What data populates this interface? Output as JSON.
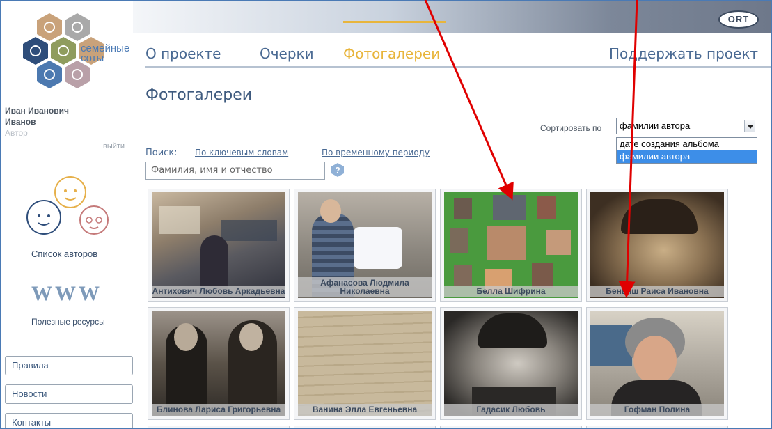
{
  "header": {
    "sponsor_logo": "ORT"
  },
  "logo": {
    "line1": "семейные",
    "line2": "соты"
  },
  "user": {
    "name_line1": "Иван Иванович",
    "name_line2": "Иванов",
    "role": "Автор",
    "logout": "выйти"
  },
  "sidebar": {
    "authors_label": "Список авторов",
    "www_label": "WWW",
    "resources_label": "Полезные ресурсы",
    "buttons": [
      "Правила",
      "Новости",
      "Контакты"
    ]
  },
  "nav": {
    "items": [
      "О проекте",
      "Очерки",
      "Фотогалереи"
    ],
    "support": "Поддержать проект",
    "active": "Фотогалереи"
  },
  "page": {
    "title": "Фотогалереи"
  },
  "sort": {
    "label": "Сортировать по",
    "selected": "фамилии автора",
    "options": [
      "дате создания альбома",
      "фамилии автора"
    ]
  },
  "search": {
    "label": "Поиск:",
    "by_keywords": "По ключевым словам",
    "by_period": "По временному периоду",
    "placeholder": "Фамилия, имя и отчество"
  },
  "gallery": [
    {
      "caption": "Антихович Любовь Аркадьевна"
    },
    {
      "caption": "Афанасова Людмила Николаевна"
    },
    {
      "caption": "Белла Шифрина"
    },
    {
      "caption": "Беньяш Раиса Ивановна"
    },
    {
      "caption": "Блинова Лариса Григорьевна"
    },
    {
      "caption": "Ванина Элла Евгеньевна"
    },
    {
      "caption": "Гадасик Любовь"
    },
    {
      "caption": "Гофман Полина"
    }
  ],
  "colors": {
    "accent": "#e8b53c",
    "link": "#4a6a93",
    "arrow": "#e00000",
    "selected_option": "#3d8ee8"
  }
}
